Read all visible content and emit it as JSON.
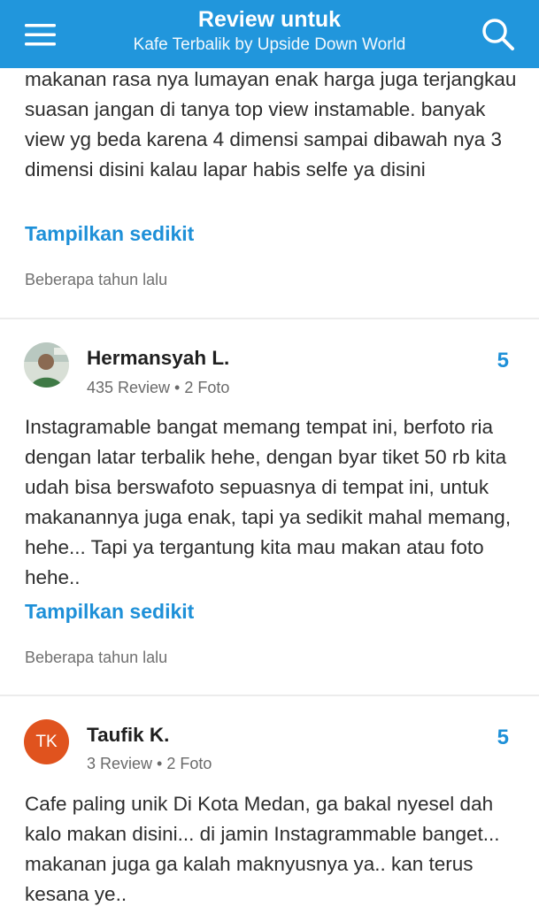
{
  "header": {
    "title": "Review untuk",
    "subtitle": "Kafe Terbalik by Upside Down World",
    "menu_icon": "hamburger-menu-icon",
    "search_icon": "search-icon",
    "bg_color": "#2196dc"
  },
  "reviews": [
    {
      "text": "makanan rasa nya lumayan enak harga juga terjangkau suasan jangan di tanya top view instamable. banyak view yg beda karena 4 dimensi sampai dibawah nya 3 dimensi disini kalau lapar habis selfe ya disini",
      "toggle": "Tampilkan sedikit",
      "time": "Beberapa tahun lalu"
    },
    {
      "name": "Hermansyah L.",
      "meta": "435 Review • 2 Foto",
      "rating": "5",
      "text": "Instagramable bangat memang tempat ini, berfoto ria dengan latar terbalik hehe, dengan byar tiket 50 rb kita udah bisa berswafoto sepuasnya di tempat ini, untuk makanannya juga enak, tapi ya sedikit mahal memang, hehe... Tapi ya tergantung kita mau makan atau foto hehe..",
      "toggle": "Tampilkan sedikit",
      "time": "Beberapa tahun lalu"
    },
    {
      "initials": "TK",
      "name": "Taufik K.",
      "meta": "3 Review • 2 Foto",
      "rating": "5",
      "text": "Cafe paling unik Di Kota Medan, ga bakal nyesel dah kalo makan disini... di jamin Instagrammable banget... makanan juga ga kalah maknyusnya ya.. kan terus kesana ye.."
    }
  ],
  "accent_color": "#1e90d8",
  "avatar_color": "#e0531e"
}
